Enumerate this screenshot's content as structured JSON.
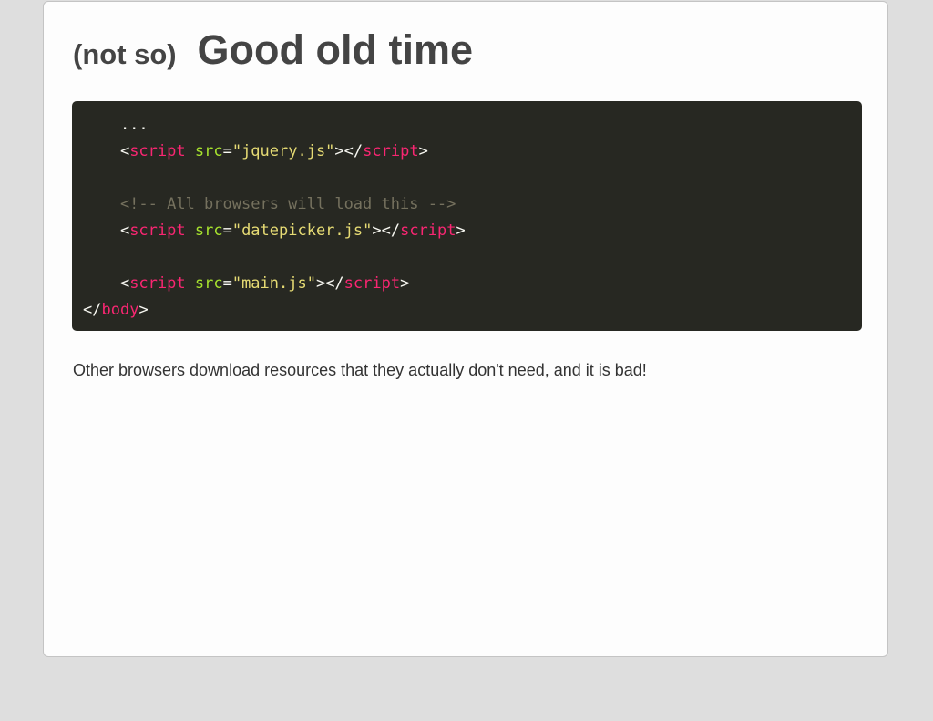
{
  "slide": {
    "title_prefix": "(not so)",
    "title_main": "Good old time",
    "caption": "Other browsers download resources that they actually don't need, and it is bad!"
  },
  "code": {
    "colors": {
      "background": "#272822",
      "tag": "#f92672",
      "attribute": "#a6e22e",
      "string": "#e6db74",
      "comment": "#75715e",
      "text": "#f8f8f2"
    },
    "lines": [
      [
        {
          "t": "plain",
          "v": "    ..."
        }
      ],
      [
        {
          "t": "punct",
          "v": "    <"
        },
        {
          "t": "tag",
          "v": "script"
        },
        {
          "t": "plain",
          "v": " "
        },
        {
          "t": "attr",
          "v": "src"
        },
        {
          "t": "punct",
          "v": "="
        },
        {
          "t": "str",
          "v": "\"jquery.js\""
        },
        {
          "t": "punct",
          "v": "></"
        },
        {
          "t": "tag",
          "v": "script"
        },
        {
          "t": "punct",
          "v": ">"
        }
      ],
      [],
      [
        {
          "t": "comment",
          "v": "    <!-- All browsers will load this -->"
        }
      ],
      [
        {
          "t": "punct",
          "v": "    <"
        },
        {
          "t": "tag",
          "v": "script"
        },
        {
          "t": "plain",
          "v": " "
        },
        {
          "t": "attr",
          "v": "src"
        },
        {
          "t": "punct",
          "v": "="
        },
        {
          "t": "str",
          "v": "\"datepicker.js\""
        },
        {
          "t": "punct",
          "v": "></"
        },
        {
          "t": "tag",
          "v": "script"
        },
        {
          "t": "punct",
          "v": ">"
        }
      ],
      [],
      [
        {
          "t": "punct",
          "v": "    <"
        },
        {
          "t": "tag",
          "v": "script"
        },
        {
          "t": "plain",
          "v": " "
        },
        {
          "t": "attr",
          "v": "src"
        },
        {
          "t": "punct",
          "v": "="
        },
        {
          "t": "str",
          "v": "\"main.js\""
        },
        {
          "t": "punct",
          "v": "></"
        },
        {
          "t": "tag",
          "v": "script"
        },
        {
          "t": "punct",
          "v": ">"
        }
      ],
      [
        {
          "t": "punct",
          "v": "</"
        },
        {
          "t": "tag",
          "v": "body"
        },
        {
          "t": "punct",
          "v": ">"
        }
      ]
    ]
  }
}
